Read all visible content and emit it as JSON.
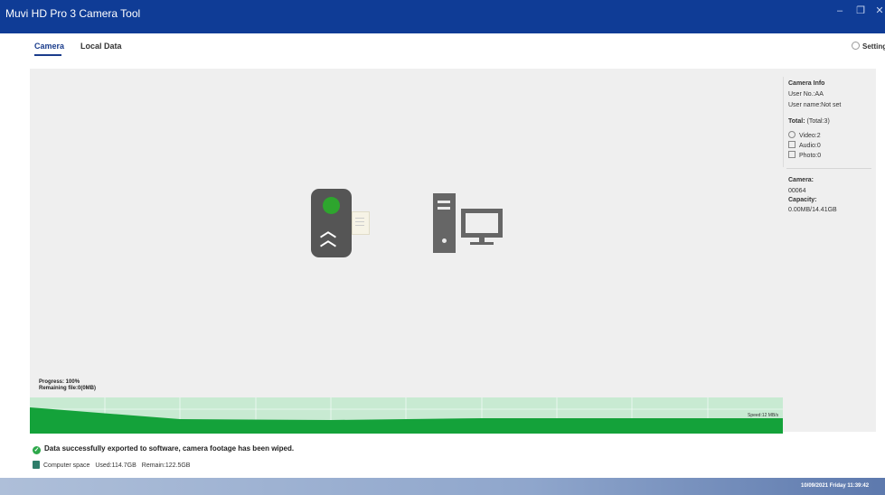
{
  "window": {
    "title": "Muvi HD Pro 3 Camera Tool",
    "controls": {
      "minimize": "–",
      "maximize": "❐",
      "close": "✕"
    }
  },
  "tabs": [
    {
      "label": "Camera",
      "active": true
    },
    {
      "label": "Local Data",
      "active": false
    }
  ],
  "settings_label": "Setting",
  "camera_info": {
    "heading": "Camera Info",
    "user_no": "User No.:AA",
    "user_name": "User name:Not set",
    "total_label": "Total:",
    "total_value": "(Total:3)",
    "video": "Video:2",
    "audio": "Audio:0",
    "photo": "Photo:0",
    "camera_label": "Camera:",
    "camera_id": "00064",
    "capacity_label": "Capacity:",
    "capacity_value": "0.00MB/14.41GB"
  },
  "progress": {
    "label": "Progress:  100%",
    "remaining": "Remaining file:0(0MB)"
  },
  "speed": {
    "label": "Speed:12 MB/s"
  },
  "status": {
    "message": "Data successfully exported to software, camera footage has been wiped.",
    "computer_space_label": "Computer space",
    "used": "Used:114.7GB",
    "remain": "Remain:122.5GB"
  },
  "footer": {
    "datetime": "10/09/2021 Friday 11:39:42"
  },
  "colors": {
    "titlebar": "#0f3c96",
    "accent": "#1a3c8c",
    "success_green": "#2da84a",
    "chart_fill": "#14a23a",
    "chart_bg": "#c8ead2"
  },
  "icons": {
    "video": "video-icon",
    "audio": "audio-icon",
    "photo": "photo-icon",
    "success": "check-circle-icon",
    "disk": "disk-icon",
    "settings": "gear-icon"
  }
}
